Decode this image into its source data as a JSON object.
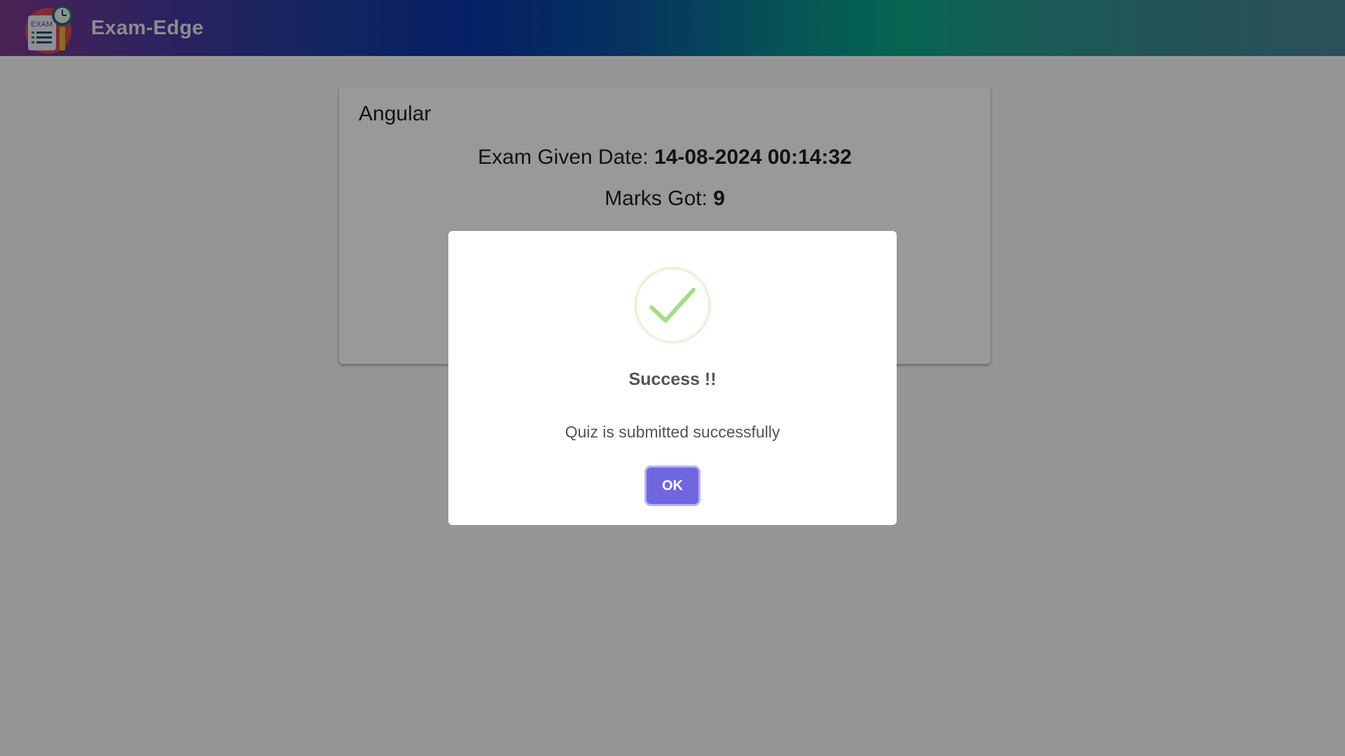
{
  "header": {
    "brand": "Exam-Edge",
    "logo_icon": "exam-clipboard-clock-logo",
    "logo_text": "EXAM"
  },
  "result_card": {
    "subject": "Angular",
    "date_label": "Exam Given Date: ",
    "date_value": "14-08-2024 00:14:32",
    "marks_label": "Marks Got: ",
    "marks_value": "9"
  },
  "dialog": {
    "icon": "success-check-icon",
    "title": "Success !!",
    "message": "Quiz is submitted successfully",
    "ok_label": "OK"
  },
  "colors": {
    "confirm_button": "#7066e0",
    "success_check": "#a5dc86",
    "overlay": "rgba(0,0,0,0.4)"
  }
}
